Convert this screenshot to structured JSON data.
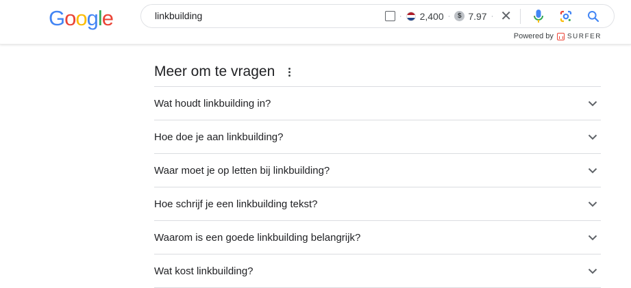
{
  "logo": {
    "letters": [
      "G",
      "o",
      "o",
      "g",
      "l",
      "e"
    ],
    "colors": [
      "#4285f4",
      "#ea4335",
      "#fbbc05",
      "#4285f4",
      "#34a853",
      "#ea4335"
    ]
  },
  "search": {
    "query": "linkbuilding",
    "volume": "2,400",
    "cpc": "7.97",
    "dollar_symbol": "$",
    "separator": "·",
    "country": "Netherlands",
    "flag_colors": [
      "#ae1c28",
      "#ffffff",
      "#21468b"
    ],
    "clear_symbol": "✕"
  },
  "icons": {
    "mic": "mic-icon",
    "lens": "google-lens-icon",
    "search": "search-icon"
  },
  "powered": {
    "text": "Powered by",
    "brand": "SURFER"
  },
  "paa": {
    "title": "Meer om te vragen",
    "questions": [
      "Wat houdt linkbuilding in?",
      "Hoe doe je aan linkbuilding?",
      "Waar moet je op letten bij linkbuilding?",
      "Hoe schrijf je een linkbuilding tekst?",
      "Waarom is een goede linkbuilding belangrijk?",
      "Wat kost linkbuilding?"
    ]
  }
}
